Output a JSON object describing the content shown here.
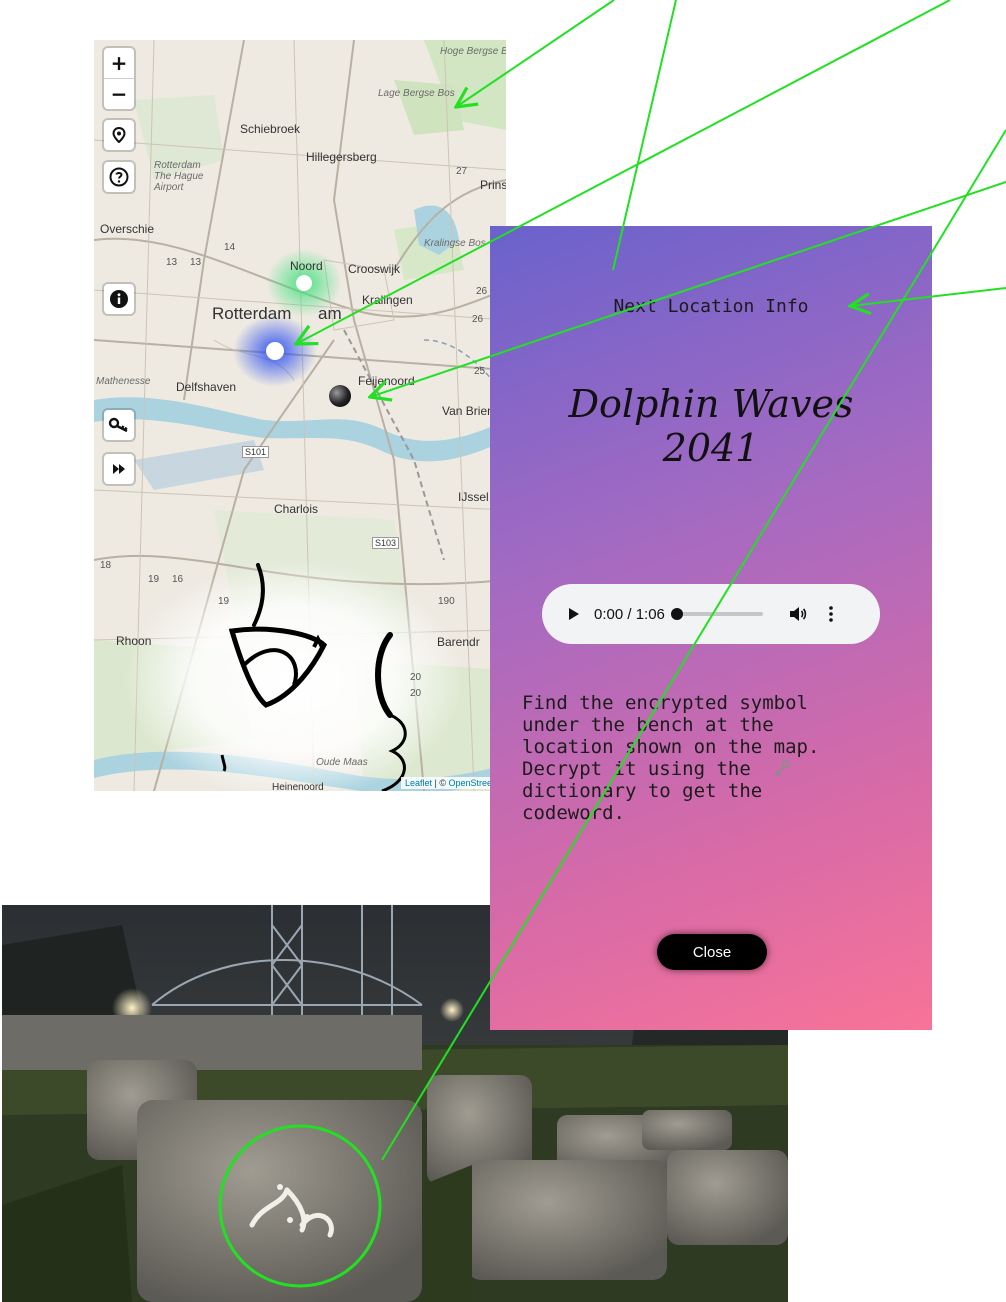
{
  "map": {
    "zoom_in_label": "+",
    "zoom_out_label": "−",
    "icons": [
      "location-pin-icon",
      "help-icon",
      "info-icon",
      "key-icon",
      "fast-forward-icon"
    ],
    "labels": {
      "hoge_bergse_bos": "Hoge Bergse Bos",
      "lage_bergse_bos": "Lage Bergse Bos",
      "schiebroek": "Schiebroek",
      "hillegersberg": "Hillegersberg",
      "airport": "Rotterdam The Hague Airport",
      "prins": "Prins",
      "overschie": "Overschie",
      "kralingse_bos": "Kralingse Bos",
      "noord": "Noord",
      "crooswijk": "Crooswijk",
      "kralingen": "Kralingen",
      "rotterdam": "Rotterdam",
      "am": "am",
      "mathenesse": "Mathenesse",
      "delfshaven": "Delfshaven",
      "feijenoord": "Feijenoord",
      "van_brien": "Van Brien",
      "s101": "S101",
      "charlois": "Charlois",
      "ijssel": "IJssel",
      "s103": "S103",
      "rhoon": "Rhoon",
      "barendr": "Barendr",
      "oude_maas": "Oude Maas",
      "heinenoord": "Heinenoord",
      "r13a": "13",
      "r13b": "13",
      "r14": "14",
      "r18": "18",
      "r19a": "19",
      "r19b": "19",
      "r20a": "20",
      "r20b": "20",
      "r25": "25",
      "r26a": "26",
      "r26b": "26",
      "r27": "27",
      "r190": "190",
      "r16": "16"
    },
    "attribution_leaflet": "Leaflet",
    "attribution_sep": " | © ",
    "attribution_osm": "OpenStreetM"
  },
  "modal": {
    "title": "Next Location Info",
    "location_name_line1": "Dolphin Waves",
    "location_name_line2": "2041",
    "audio": {
      "time": "0:00 / 1:06",
      "progress": 0
    },
    "instructions_lines": [
      "Find the encrypted symbol",
      "under the bench at the",
      "location shown on the map.",
      "Decrypt it using the",
      "dictionary to get the",
      "codeword."
    ],
    "instruction_icon": "key-icon",
    "close_label": "Close"
  },
  "colors": {
    "gradient_start": "#6a62cc",
    "gradient_end": "#f87398",
    "annotation_line": "#22e022",
    "marker_green": "#3ee07a",
    "marker_blue": "#2a4ef0"
  }
}
